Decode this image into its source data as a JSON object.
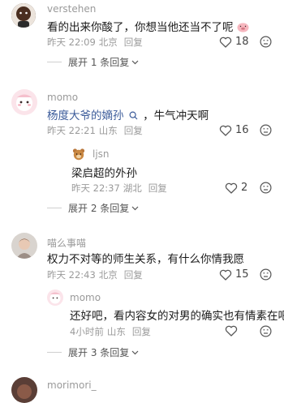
{
  "comments": [
    {
      "username": "verstehen",
      "text": "看的出来你酸了，你想当他还当不了呢",
      "time": "昨天 22:09",
      "location": "北京",
      "reply_label": "回复",
      "likes": "18",
      "expand_label": "展开 1 条回复"
    },
    {
      "username": "momo",
      "mention": "杨度大爷的嫡孙",
      "text_rest": "，牛气冲天啊",
      "time": "昨天 22:21",
      "location": "山东",
      "reply_label": "回复",
      "likes": "16",
      "reply": {
        "username": "ljsn",
        "text": "梁启超的外孙",
        "time": "昨天 22:37",
        "location": "湖北",
        "reply_label": "回复",
        "likes": "2"
      },
      "expand_label": "展开 2 条回复"
    },
    {
      "username": "喵么事喵",
      "text": "权力不对等的师生关系，有什么你情我愿",
      "time": "昨天 22:43",
      "location": "北京",
      "reply_label": "回复",
      "likes": "15",
      "reply": {
        "username": "momo",
        "text": "还好吧，看内容女的对男的确实也有情素在吧",
        "time": "4小时前",
        "location": "山东",
        "reply_label": "回复",
        "likes": ""
      },
      "expand_label": "展开 3 条回复"
    },
    {
      "username": "morimori_"
    }
  ],
  "icons": {
    "heart": "heart-icon",
    "dislike": "dislike-face-icon",
    "chevron": "chevron-down-icon"
  }
}
